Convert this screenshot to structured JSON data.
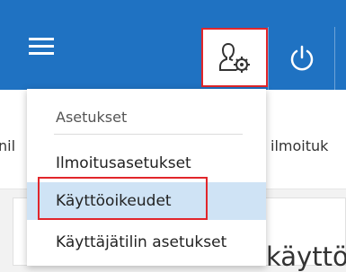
{
  "topbar": {
    "menu_icon": "hamburger-menu-icon",
    "user_icon": "user-settings-icon",
    "power_icon": "power-icon",
    "accent": "#1f72c2",
    "highlight": "#e1262b"
  },
  "subbar": {
    "left_text": "nil",
    "right_text": "ilmoituk"
  },
  "background_text": "käyttö",
  "dropdown": {
    "header": "Asetukset",
    "items": [
      {
        "label": "Ilmoitusasetukset"
      },
      {
        "label": "Käyttöoikeudet",
        "selected": true
      },
      {
        "label": "Käyttäjätilin asetukset"
      }
    ]
  }
}
